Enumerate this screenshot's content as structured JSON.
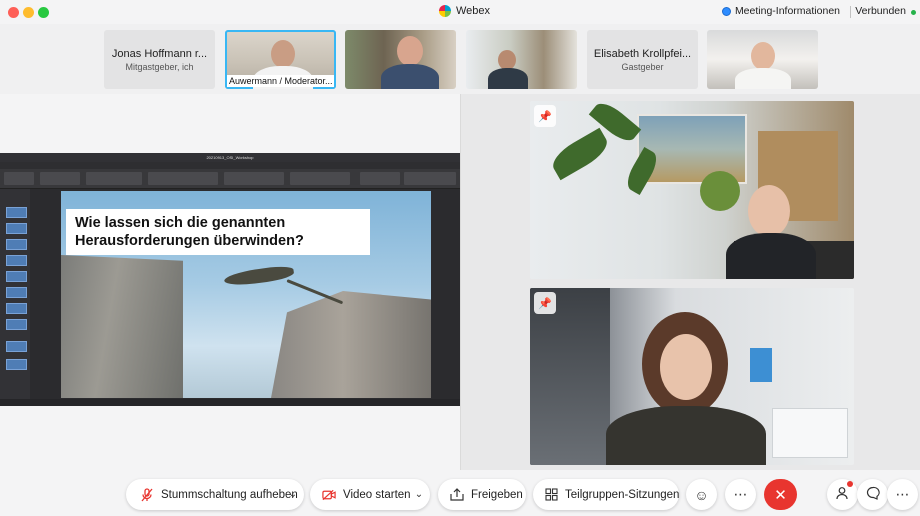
{
  "window": {
    "app_title": "Webex",
    "meeting_info": "Meeting-Informationen",
    "status": "Verbunden"
  },
  "participants": [
    {
      "type": "name",
      "name": "Jonas Hoffmann r...",
      "role": "Mitgastgeber, ich"
    },
    {
      "type": "video",
      "caption": "Auwermann / Moderator...",
      "active": true
    },
    {
      "type": "video",
      "caption": ""
    },
    {
      "type": "video",
      "caption": ""
    },
    {
      "type": "name",
      "name": "Elisabeth Krollpfei...",
      "role": "Gastgeber"
    },
    {
      "type": "video",
      "caption": ""
    }
  ],
  "shared_content": {
    "window_title": "20210913_OSI_Workshop",
    "slide_title_line1": "Wie lassen sich die genannten",
    "slide_title_line2": "Herausforderungen überwinden?"
  },
  "controls": {
    "mute": "Stummschaltung aufheben",
    "video": "Video starten",
    "share": "Freigeben",
    "breakout": "Teilgruppen-Sitzungen",
    "reactions_icon": "smiley-icon",
    "more_icon": "ellipsis-icon",
    "end_icon": "close-icon"
  },
  "colors": {
    "accent_blue": "#38b7f4",
    "end_red": "#e8352f",
    "mute_red": "#e8352f",
    "connected_green": "#25b24a"
  }
}
